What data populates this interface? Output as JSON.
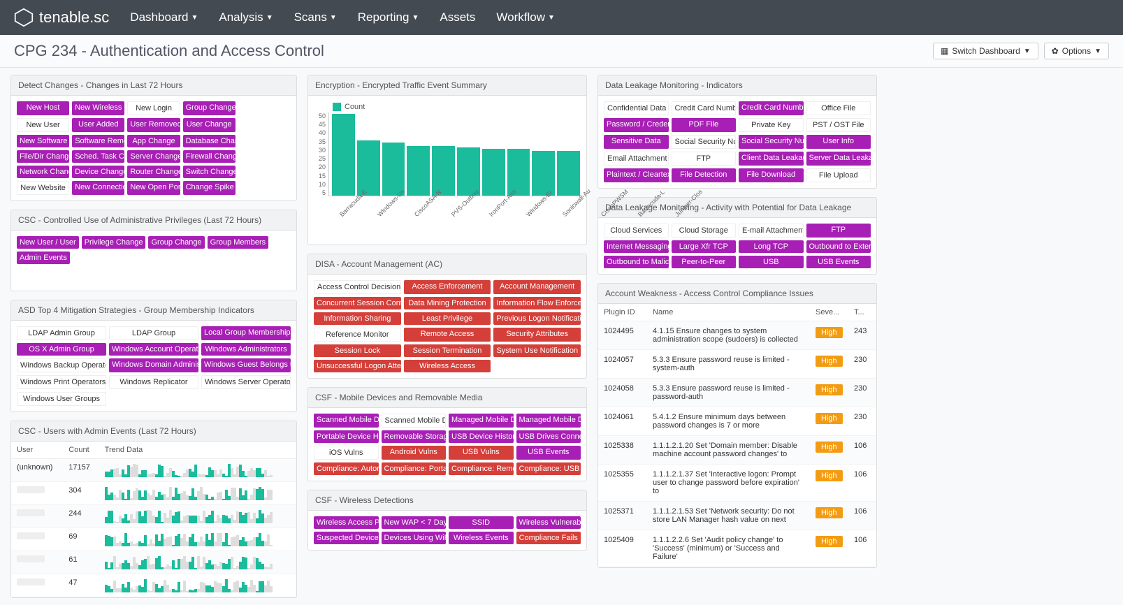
{
  "brand": "tenable.sc",
  "nav": [
    "Dashboard",
    "Analysis",
    "Scans",
    "Reporting",
    "Assets",
    "Workflow"
  ],
  "nav_caret": [
    true,
    true,
    true,
    true,
    false,
    true
  ],
  "page_title": "CPG 234 - Authentication and Access Control",
  "btn_switch": "Switch Dashboard",
  "btn_options": "Options",
  "panels": {
    "changes": {
      "title": "Detect Changes - Changes in Last 72 Hours",
      "items": [
        {
          "t": "New Host",
          "c": "purple"
        },
        {
          "t": "New Wireless Host",
          "c": "purple"
        },
        {
          "t": "New Login",
          "c": "white"
        },
        {
          "t": "Group Change",
          "c": "purple"
        },
        {
          "t": "",
          "c": "white"
        },
        {
          "t": "New User",
          "c": "white"
        },
        {
          "t": "User Added",
          "c": "purple"
        },
        {
          "t": "User Removed",
          "c": "purple"
        },
        {
          "t": "User Change",
          "c": "purple"
        },
        {
          "t": "",
          "c": "white"
        },
        {
          "t": "New Software",
          "c": "purple"
        },
        {
          "t": "Software Removed",
          "c": "purple"
        },
        {
          "t": "App Change",
          "c": "purple"
        },
        {
          "t": "Database Change",
          "c": "purple"
        },
        {
          "t": "",
          "c": "white"
        },
        {
          "t": "File/Dir Change",
          "c": "purple"
        },
        {
          "t": "Sched. Task Change",
          "c": "purple"
        },
        {
          "t": "Server Change",
          "c": "purple"
        },
        {
          "t": "Firewall Change",
          "c": "purple"
        },
        {
          "t": "",
          "c": "white"
        },
        {
          "t": "Network Change",
          "c": "purple"
        },
        {
          "t": "Device Change",
          "c": "purple"
        },
        {
          "t": "Router Change",
          "c": "purple"
        },
        {
          "t": "Switch Change",
          "c": "purple"
        },
        {
          "t": "",
          "c": "white"
        },
        {
          "t": "New Website",
          "c": "white"
        },
        {
          "t": "New Connection",
          "c": "purple"
        },
        {
          "t": "New Open Port",
          "c": "purple"
        },
        {
          "t": "Change Spike",
          "c": "purple"
        },
        {
          "t": "",
          "c": "white"
        }
      ]
    },
    "csc_admin": {
      "title": "CSC - Controlled Use of Administrative Privileges (Last 72 Hours)",
      "items": [
        {
          "t": "New User / User",
          "c": "purple"
        },
        {
          "t": "Privilege Change",
          "c": "purple"
        },
        {
          "t": "Group Change",
          "c": "purple"
        },
        {
          "t": "Group Members",
          "c": "purple"
        },
        {
          "t": "Admin Events",
          "c": "purple"
        }
      ]
    },
    "asd": {
      "title": "ASD Top 4 Mitigation Strategies - Group Membership Indicators",
      "items": [
        {
          "t": "LDAP Admin Group",
          "c": "white"
        },
        {
          "t": "LDAP Group",
          "c": "white"
        },
        {
          "t": "Local Group Memberships",
          "c": "purple"
        },
        {
          "t": "OS X Admin Group",
          "c": "purple"
        },
        {
          "t": "Windows Account Operators",
          "c": "purple"
        },
        {
          "t": "Windows Administrators",
          "c": "purple"
        },
        {
          "t": "Windows Backup Operators",
          "c": "white"
        },
        {
          "t": "Windows Domain Administrators",
          "c": "purple"
        },
        {
          "t": "Windows Guest Belongs to a",
          "c": "purple"
        },
        {
          "t": "Windows Print Operators",
          "c": "white"
        },
        {
          "t": "Windows Replicator",
          "c": "white"
        },
        {
          "t": "Windows Server Operators",
          "c": "white"
        },
        {
          "t": "Windows User Groups",
          "c": "white"
        },
        {
          "t": "",
          "c": "white"
        },
        {
          "t": "",
          "c": "white"
        }
      ]
    },
    "csc_users": {
      "title": "CSC - Users with Admin Events (Last 72 Hours)",
      "headers": [
        "User",
        "Count",
        "Trend Data"
      ],
      "rows": [
        {
          "user": "(unknown)",
          "count": "17157"
        },
        {
          "user": "",
          "count": "304"
        },
        {
          "user": "",
          "count": "244"
        },
        {
          "user": "",
          "count": "69"
        },
        {
          "user": "",
          "count": "61"
        },
        {
          "user": "",
          "count": "47"
        }
      ]
    },
    "encryption": {
      "title": "Encryption - Encrypted Traffic Event Summary"
    },
    "disa": {
      "title": "DISA - Account Management (AC)",
      "items": [
        {
          "t": "Access Control Decisions",
          "c": "white"
        },
        {
          "t": "Access Enforcement",
          "c": "red"
        },
        {
          "t": "Account Management",
          "c": "red"
        },
        {
          "t": "Concurrent Session Control",
          "c": "red"
        },
        {
          "t": "Data Mining Protection",
          "c": "red"
        },
        {
          "t": "Information Flow Enforcement",
          "c": "red"
        },
        {
          "t": "Information Sharing",
          "c": "red"
        },
        {
          "t": "Least Privilege",
          "c": "red"
        },
        {
          "t": "Previous Logon Notification",
          "c": "red"
        },
        {
          "t": "Reference Monitor",
          "c": "white"
        },
        {
          "t": "Remote Access",
          "c": "red"
        },
        {
          "t": "Security Attributes",
          "c": "red"
        },
        {
          "t": "Session Lock",
          "c": "red"
        },
        {
          "t": "Session Termination",
          "c": "red"
        },
        {
          "t": "System Use Notification",
          "c": "red"
        },
        {
          "t": "Unsuccessful Logon Attempts",
          "c": "red"
        },
        {
          "t": "Wireless Access",
          "c": "red"
        },
        {
          "t": "",
          "c": "white"
        }
      ]
    },
    "csf_mobile": {
      "title": "CSF - Mobile Devices and Removable Media",
      "items": [
        {
          "t": "Scanned Mobile Devices",
          "c": "purple"
        },
        {
          "t": "Scanned Mobile Devices",
          "c": "white"
        },
        {
          "t": "Managed Mobile Devices",
          "c": "purple"
        },
        {
          "t": "Managed Mobile Devices",
          "c": "purple"
        },
        {
          "t": "Portable Device History",
          "c": "purple"
        },
        {
          "t": "Removable Storage",
          "c": "purple"
        },
        {
          "t": "USB Device History",
          "c": "purple"
        },
        {
          "t": "USB Drives Connected",
          "c": "purple"
        },
        {
          "t": "iOS Vulns",
          "c": "white"
        },
        {
          "t": "Android Vulns",
          "c": "red"
        },
        {
          "t": "USB Vulns",
          "c": "red"
        },
        {
          "t": "USB Events",
          "c": "purple"
        },
        {
          "t": "Compliance: Autorun",
          "c": "red"
        },
        {
          "t": "Compliance: Portable",
          "c": "red"
        },
        {
          "t": "Compliance: Removable",
          "c": "red"
        },
        {
          "t": "Compliance: USB",
          "c": "red"
        }
      ]
    },
    "csf_wireless": {
      "title": "CSF - Wireless Detections",
      "items": [
        {
          "t": "Wireless Access Points",
          "c": "purple"
        },
        {
          "t": "New WAP < 7 Days",
          "c": "purple"
        },
        {
          "t": "SSID",
          "c": "purple"
        },
        {
          "t": "Wireless Vulnerabilities",
          "c": "purple"
        },
        {
          "t": "Suspected Devices",
          "c": "purple"
        },
        {
          "t": "Devices Using WiFi",
          "c": "purple"
        },
        {
          "t": "Wireless Events",
          "c": "purple"
        },
        {
          "t": "Compliance Fails",
          "c": "red"
        }
      ]
    },
    "dlm_ind": {
      "title": "Data Leakage Monitoring - Indicators",
      "items": [
        {
          "t": "Confidential Data",
          "c": "white"
        },
        {
          "t": "Credit Card Number",
          "c": "white"
        },
        {
          "t": "Credit Card Number",
          "c": "purple"
        },
        {
          "t": "Office File",
          "c": "white"
        },
        {
          "t": "Password / Credentials",
          "c": "purple"
        },
        {
          "t": "PDF File",
          "c": "purple"
        },
        {
          "t": "Private Key",
          "c": "white"
        },
        {
          "t": "PST / OST File",
          "c": "white"
        },
        {
          "t": "Sensitive Data",
          "c": "purple"
        },
        {
          "t": "Social Security Number",
          "c": "white"
        },
        {
          "t": "Social Security Number",
          "c": "purple"
        },
        {
          "t": "User Info",
          "c": "purple"
        },
        {
          "t": "Email Attachment",
          "c": "white"
        },
        {
          "t": "FTP",
          "c": "white"
        },
        {
          "t": "Client Data Leakage",
          "c": "purple"
        },
        {
          "t": "Server Data Leakage",
          "c": "purple"
        },
        {
          "t": "Plaintext / Cleartext",
          "c": "purple"
        },
        {
          "t": "File Detection",
          "c": "purple"
        },
        {
          "t": "File Download",
          "c": "purple"
        },
        {
          "t": "File Upload",
          "c": "white"
        }
      ]
    },
    "dlm_activity": {
      "title": "Data Leakage Monitoring - Activity with Potential for Data Leakage",
      "items": [
        {
          "t": "Cloud Services",
          "c": "white"
        },
        {
          "t": "Cloud Storage",
          "c": "white"
        },
        {
          "t": "E-mail Attachment",
          "c": "white"
        },
        {
          "t": "FTP",
          "c": "purple"
        },
        {
          "t": "Internet Messaging",
          "c": "purple"
        },
        {
          "t": "Large Xfr TCP",
          "c": "purple"
        },
        {
          "t": "Long TCP",
          "c": "purple"
        },
        {
          "t": "Outbound to External",
          "c": "purple"
        },
        {
          "t": "Outbound to Malicious",
          "c": "purple"
        },
        {
          "t": "Peer-to-Peer",
          "c": "purple"
        },
        {
          "t": "USB",
          "c": "purple"
        },
        {
          "t": "USB Events",
          "c": "purple"
        }
      ]
    },
    "weakness": {
      "title": "Account Weakness - Access Control Compliance Issues",
      "headers": [
        "Plugin ID",
        "Name",
        "Seve...",
        "T..."
      ],
      "rows": [
        {
          "id": "1024495",
          "name": "4.1.15 Ensure changes to system administration scope (sudoers) is collected",
          "sev": "High",
          "t": "243"
        },
        {
          "id": "1024057",
          "name": "5.3.3 Ensure password reuse is limited - system-auth",
          "sev": "High",
          "t": "230"
        },
        {
          "id": "1024058",
          "name": "5.3.3 Ensure password reuse is limited - password-auth",
          "sev": "High",
          "t": "230"
        },
        {
          "id": "1024061",
          "name": "5.4.1.2 Ensure minimum days between password changes is 7 or more",
          "sev": "High",
          "t": "230"
        },
        {
          "id": "1025338",
          "name": "1.1.1.2.1.20 Set 'Domain member: Disable machine account password changes' to",
          "sev": "High",
          "t": "106"
        },
        {
          "id": "1025355",
          "name": "1.1.1.2.1.37 Set 'Interactive logon: Prompt user to change password before expiration' to",
          "sev": "High",
          "t": "106"
        },
        {
          "id": "1025371",
          "name": "1.1.1.2.1.53 Set 'Network security: Do not store LAN Manager hash value on next",
          "sev": "High",
          "t": "106"
        },
        {
          "id": "1025409",
          "name": "1.1.1.2.2.6 Set 'Audit policy change' to 'Success' (minimum) or 'Success and Failure'",
          "sev": "High",
          "t": "106"
        }
      ]
    }
  },
  "chart_data": {
    "type": "bar",
    "legend": "Count",
    "y_ticks": [
      50,
      45,
      40,
      35,
      30,
      25,
      20,
      15,
      10,
      5
    ],
    "categories": [
      "Barracuda-E",
      "Windows-Us",
      "CiscoASA-N",
      "PVS-Outbou",
      "IronPort-Ami",
      "Windows-Er",
      "Sonicwall-Au",
      "CiscoPWSM",
      "Barracuda-L",
      "Juniper-Clos"
    ],
    "values": [
      49,
      33,
      32,
      30,
      30,
      29,
      28,
      28,
      27,
      27
    ],
    "ylim": [
      0,
      50
    ]
  }
}
